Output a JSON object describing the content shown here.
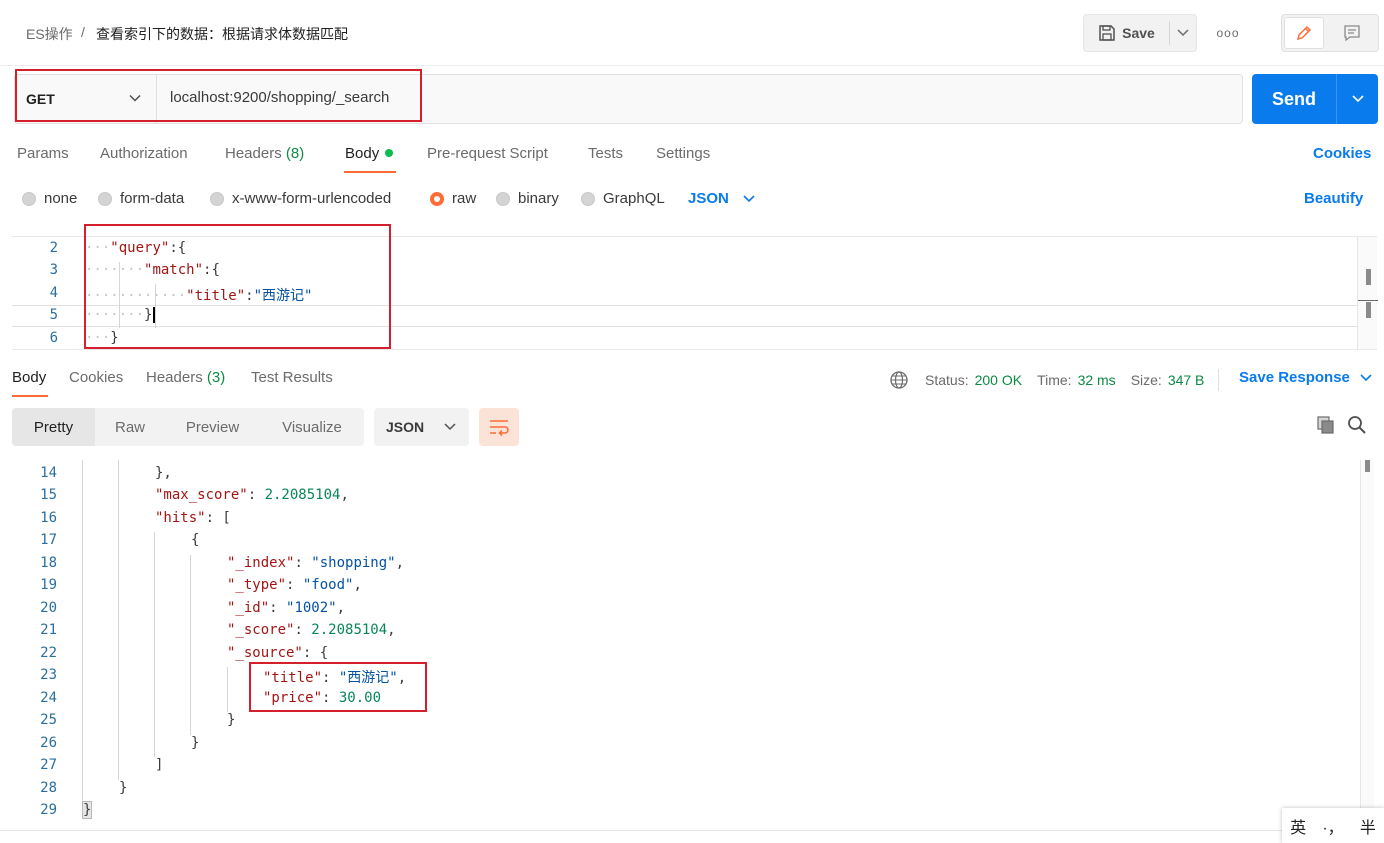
{
  "breadcrumb": {
    "collection": "ES操作",
    "separator": "/",
    "request": "查看索引下的数据：根据请求体数据匹配"
  },
  "toolbar": {
    "save_label": "Save",
    "more_label": "ooo"
  },
  "request": {
    "method": "GET",
    "url": "localhost:9200/shopping/_search",
    "send_label": "Send"
  },
  "request_tabs": {
    "params": "Params",
    "authorization": "Authorization",
    "headers": "Headers",
    "headers_count": "(8)",
    "body": "Body",
    "pre_request": "Pre-request Script",
    "tests": "Tests",
    "settings": "Settings",
    "cookies": "Cookies"
  },
  "body_types": {
    "none": "none",
    "form_data": "form-data",
    "urlencoded": "x-www-form-urlencoded",
    "raw": "raw",
    "binary": "binary",
    "graphql": "GraphQL",
    "format": "JSON",
    "beautify": "Beautify",
    "selected": "raw"
  },
  "request_body": {
    "line_numbers": [
      "2",
      "3",
      "4",
      "5",
      "6"
    ],
    "key_query": "\"query\"",
    "key_match": "\"match\"",
    "key_title": "\"title\"",
    "val_title": "\"西游记\""
  },
  "response_tabs": {
    "body": "Body",
    "cookies": "Cookies",
    "headers": "Headers",
    "headers_count": "(3)",
    "test_results": "Test Results"
  },
  "response_status": {
    "status_label": "Status:",
    "status_value": "200 OK",
    "time_label": "Time:",
    "time_value": "32 ms",
    "size_label": "Size:",
    "size_value": "347 B",
    "save_response": "Save Response"
  },
  "response_view": {
    "pretty": "Pretty",
    "raw": "Raw",
    "preview": "Preview",
    "visualize": "Visualize",
    "format": "JSON"
  },
  "response_body": {
    "line_numbers": [
      "14",
      "15",
      "16",
      "17",
      "18",
      "19",
      "20",
      "21",
      "22",
      "23",
      "24",
      "25",
      "26",
      "27",
      "28",
      "29"
    ],
    "max_score_key": "\"max_score\"",
    "max_score_val": "2.2085104",
    "hits_key": "\"hits\"",
    "index_key": "\"_index\"",
    "index_val": "\"shopping\"",
    "type_key": "\"_type\"",
    "type_val": "\"food\"",
    "id_key": "\"_id\"",
    "id_val": "\"1002\"",
    "score_key": "\"_score\"",
    "score_val": "2.2085104",
    "source_key": "\"_source\"",
    "title_key": "\"title\"",
    "title_val": "\"西游记\"",
    "price_key": "\"price\"",
    "price_val": "30.00"
  },
  "ime": {
    "lang": "英",
    "punct": "·，",
    "width": "半"
  },
  "colors": {
    "accent": "#ff6c37",
    "primary": "#097bed",
    "success": "#0c8a43",
    "annotation": "#d4202c"
  }
}
